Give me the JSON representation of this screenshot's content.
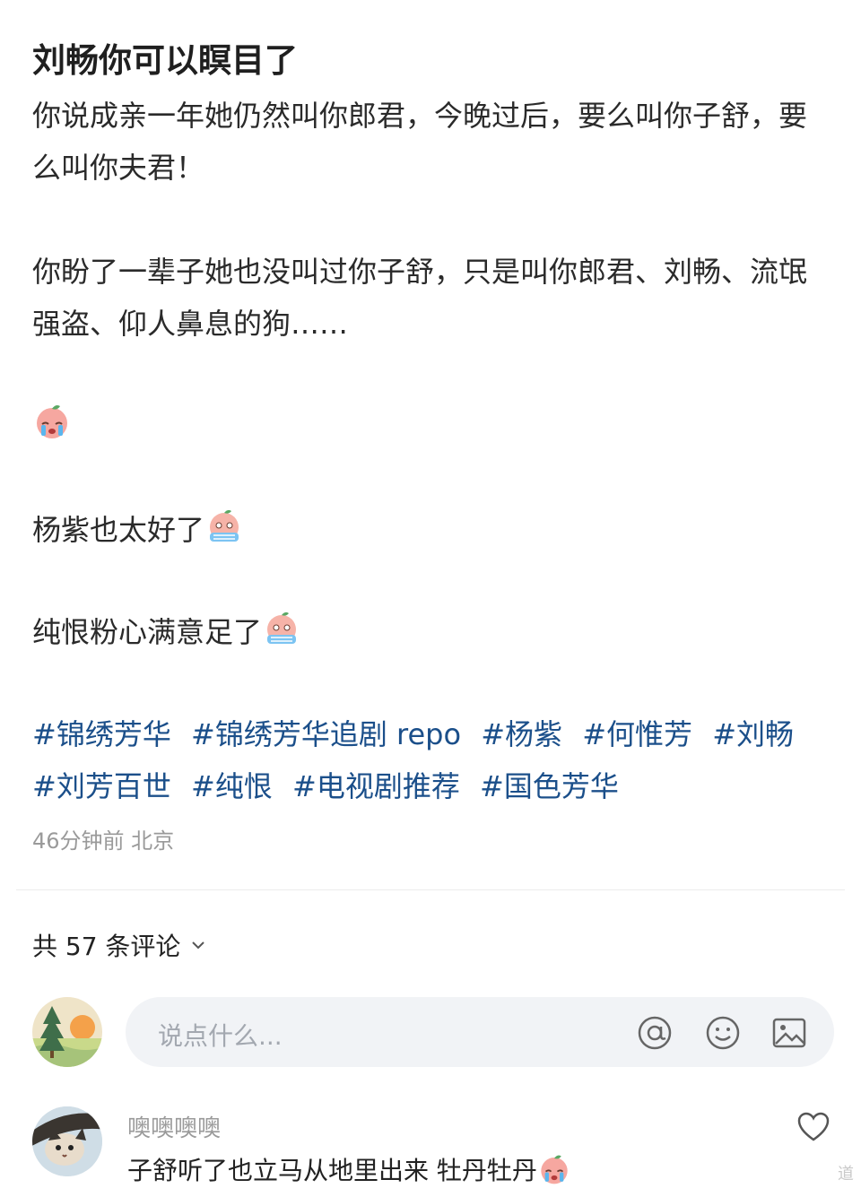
{
  "post": {
    "title": "刘畅你可以瞑目了",
    "para1": "你说成亲一年她仍然叫你郎君，今晚过后，要么叫你子舒，要么叫你夫君！",
    "para2": "你盼了一辈子她也没叫过你子舒，只是叫你郎君、刘畅、流氓强盗、仰人鼻息的狗……",
    "para3": "杨紫也太好了",
    "para4": "纯恨粉心满意足了",
    "emoji_name": "crying-peach-emoji",
    "tags": [
      "#锦绣芳华",
      "#锦绣芳华追剧 repo",
      "#杨紫",
      "#何惟芳",
      "#刘畅",
      "#刘芳百世",
      "#纯恨",
      "#电视剧推荐",
      "#国色芳华"
    ],
    "tag_color": "#1b4f8a",
    "meta": "46分钟前 北京"
  },
  "comments_header": {
    "label": "共 57 条评论"
  },
  "compose": {
    "placeholder": "说点什么..."
  },
  "comments": [
    {
      "user": "噢噢噢噢",
      "text": "子舒听了也立马从地里出来 牡丹牡丹"
    }
  ],
  "watermark": "道"
}
